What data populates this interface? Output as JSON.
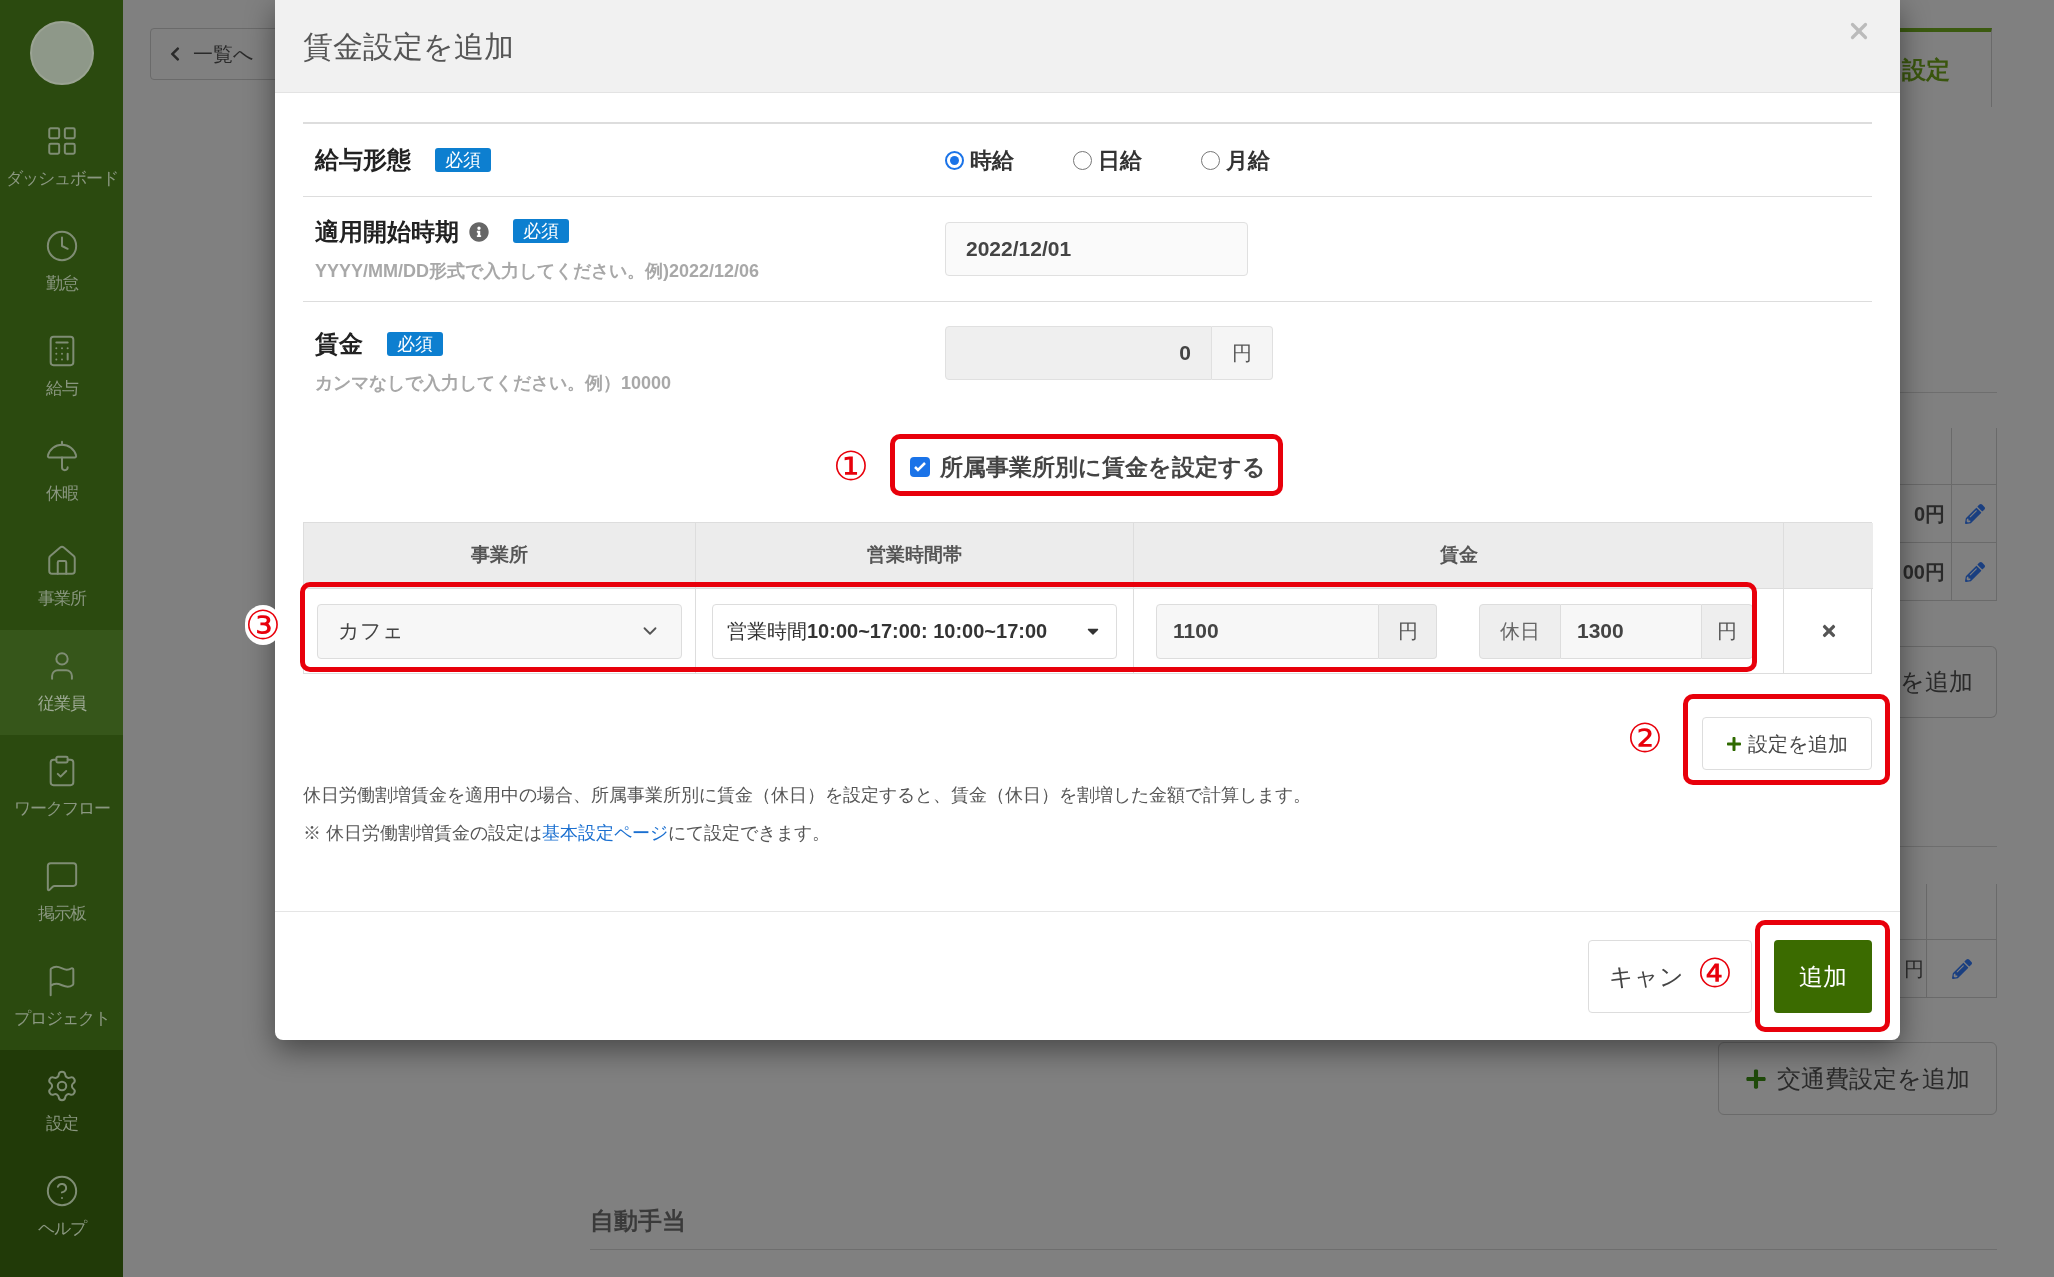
{
  "sidebar": {
    "items": [
      {
        "label": "ダッシュボード",
        "selected": false
      },
      {
        "label": "勤怠",
        "selected": false
      },
      {
        "label": "給与",
        "selected": false
      },
      {
        "label": "休暇",
        "selected": false
      },
      {
        "label": "事業所",
        "selected": false
      },
      {
        "label": "従業員",
        "selected": true
      },
      {
        "label": "ワークフロー",
        "selected": false
      },
      {
        "label": "掲示板",
        "selected": false
      },
      {
        "label": "プロジェクト",
        "selected": false
      }
    ],
    "bottom_items": [
      {
        "label": "設定",
        "selected": false
      },
      {
        "label": "ヘルプ",
        "selected": false
      }
    ]
  },
  "background": {
    "back_button": "一覧へ",
    "tab": {
      "label": "設定",
      "selected": true
    },
    "table_1_rows": [
      {
        "amount": "0円"
      },
      {
        "amount": "00円"
      }
    ],
    "add_button": "を追加",
    "table_2_rows": [
      {
        "amount": "円"
      }
    ],
    "transport_button": "交通費設定を追加",
    "section_heading": "自動手当"
  },
  "dialog": {
    "title": "賃金設定を追加",
    "fields": [
      {
        "kind": "radio",
        "label": "給与形態",
        "badge": "必須",
        "options": [
          {
            "label": "時給",
            "selected": true
          },
          {
            "label": "日給",
            "selected": false
          },
          {
            "label": "月給",
            "selected": false
          }
        ]
      },
      {
        "kind": "date",
        "label": "適用開始時期",
        "badge": "必須",
        "hint": "YYYY/MM/DD形式で入力してください。例)2022/12/06",
        "value": "2022/12/01"
      },
      {
        "kind": "amount",
        "label": "賃金",
        "badge": "必須",
        "hint": "カンマなしで入力してください。例）10000",
        "value": "0",
        "unit": "円"
      }
    ],
    "per_office": {
      "label": "所属事業所別に賃金を設定する",
      "checked": true
    },
    "office_table": {
      "columns": [
        "事業所",
        "営業時間帯",
        "賃金"
      ],
      "rows": [
        {
          "office": "カフェ",
          "hours": "営業時間**10:00~17:00: 10:00~17:00**",
          "wage": "1100",
          "wage_unit": "円",
          "holiday_label": "休日",
          "holiday_wage": "1300",
          "holiday_unit": "円"
        }
      ]
    },
    "add_setting_button": "設定を追加",
    "notes": [
      {
        "text": "休日労働割増賃金を適用中の場合、所属事業所別に賃金（休日）を設定すると、賃金（休日）を割増した金額で計算します。"
      },
      {
        "text": "※ 休日労働割増賃金の設定は",
        "link": "基本設定ページ",
        "after": "にて設定できます。"
      }
    ],
    "buttons": {
      "cancel": "キャン",
      "submit": "追加"
    }
  },
  "annotations": [
    {
      "label": "①"
    },
    {
      "label": "②"
    },
    {
      "label": "③"
    },
    {
      "label": "④"
    }
  ]
}
